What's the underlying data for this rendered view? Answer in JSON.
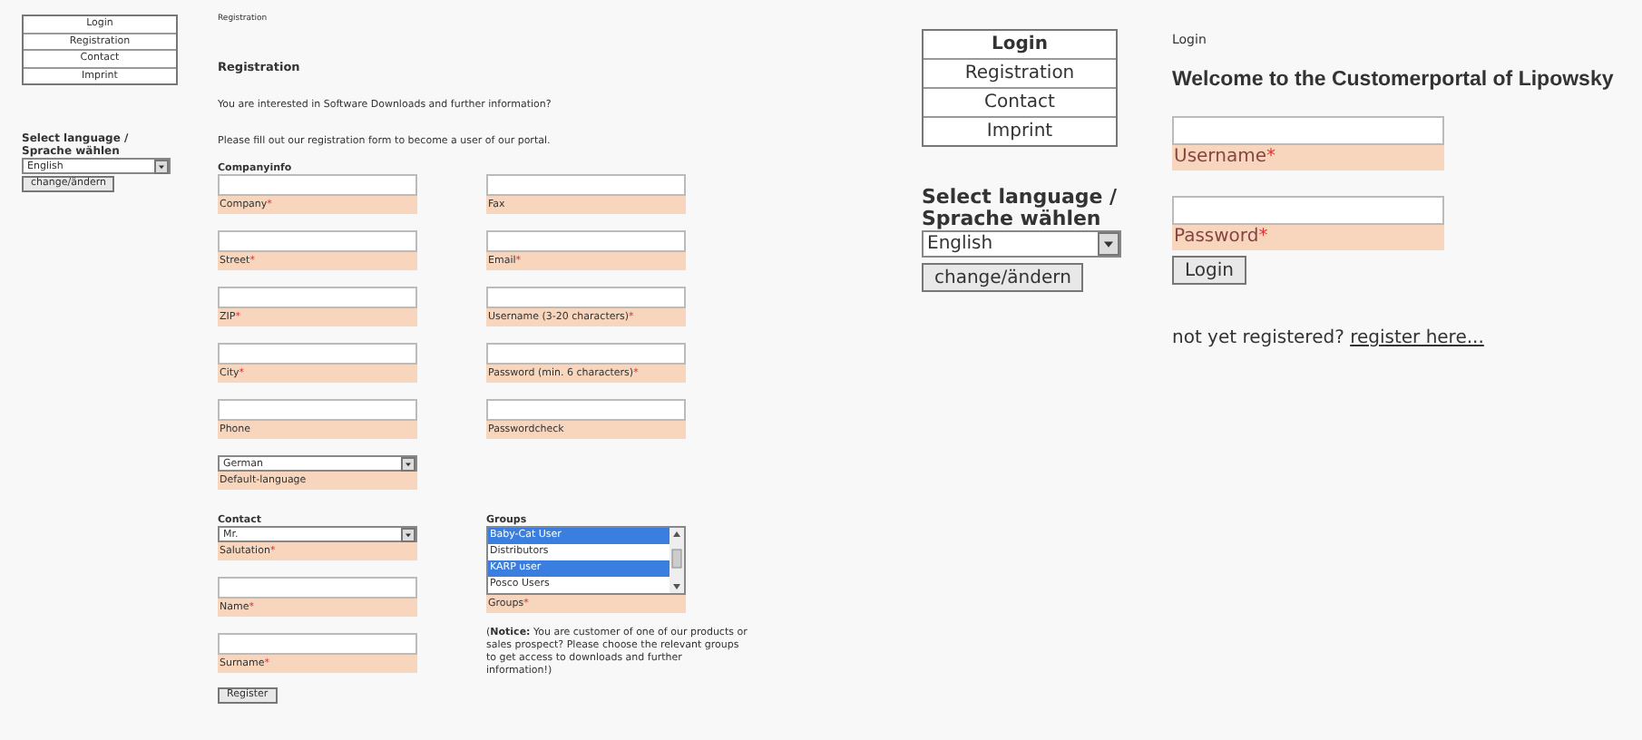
{
  "registration_page": {
    "nav": [
      {
        "label": "Login"
      },
      {
        "label": "Registration"
      },
      {
        "label": "Contact"
      },
      {
        "label": "Imprint"
      }
    ],
    "language": {
      "label": "Select language / Sprache wählen",
      "value": "English",
      "button": "change/ändern"
    },
    "breadcrumb": "Registration",
    "title": "Registration",
    "intro": [
      "You are interested in Software Downloads and further information?",
      "Please fill out our registration form to become a user of our portal."
    ],
    "companyinfo": {
      "heading": "Companyinfo",
      "fields": [
        {
          "kind": "text",
          "label": "Company",
          "required_mark": "*"
        },
        {
          "kind": "text",
          "label": "Fax"
        },
        {
          "kind": "text",
          "label": "Street",
          "required_mark": "*"
        },
        {
          "kind": "text",
          "label": "Email",
          "required_mark": "*"
        },
        {
          "kind": "text",
          "label": "ZIP",
          "required_mark": "*"
        },
        {
          "kind": "text",
          "label": "Username (3-20 characters)",
          "required_mark": "*"
        },
        {
          "kind": "text",
          "label": "City",
          "required_mark": "*"
        },
        {
          "kind": "text",
          "label": "Password (min. 6 characters)",
          "required_mark": "*"
        },
        {
          "kind": "text",
          "label": "Phone"
        },
        {
          "kind": "text",
          "label": "Passwordcheck"
        },
        {
          "kind": "select",
          "label": "Default-language",
          "value": "German"
        }
      ]
    },
    "contact": {
      "heading": "Contact",
      "fields": [
        {
          "kind": "select",
          "label": "Salutation",
          "required_mark": "*",
          "value": "Mr."
        },
        {
          "kind": "text",
          "label": "Name",
          "required_mark": "*"
        },
        {
          "kind": "text",
          "label": "Surname",
          "required_mark": "*"
        }
      ],
      "button": "Register"
    },
    "groups": {
      "heading": "Groups",
      "label": "Groups",
      "required_mark": "*",
      "options": [
        {
          "label": "Baby-Cat User",
          "selected": true
        },
        {
          "label": "Distributors",
          "selected": false
        },
        {
          "label": "KARP user",
          "selected": true
        },
        {
          "label": "Posco Users",
          "selected": false
        }
      ],
      "notice": "(**Notice:** You are customer of one of our products or sales prospect? Please choose the relevant groups to get access to downloads and further information!)"
    }
  },
  "login_page": {
    "nav": [
      {
        "label": "Login",
        "selected": true
      },
      {
        "label": "Registration",
        "selected": false
      },
      {
        "label": "Contact",
        "selected": false
      },
      {
        "label": "Imprint",
        "selected": false
      }
    ],
    "language": {
      "label": "Select language / Sprache wählen",
      "value": "English",
      "button": "change/ändern"
    },
    "breadcrumb": "Login",
    "title": "Welcome to the Customerportal of Lipowsky",
    "fields": [
      {
        "label": "Username",
        "required_mark": "*"
      },
      {
        "label": "Password",
        "required_mark": "*"
      }
    ],
    "button": "Login",
    "register_prompt": "not yet registered?",
    "register_link": "register here..."
  }
}
